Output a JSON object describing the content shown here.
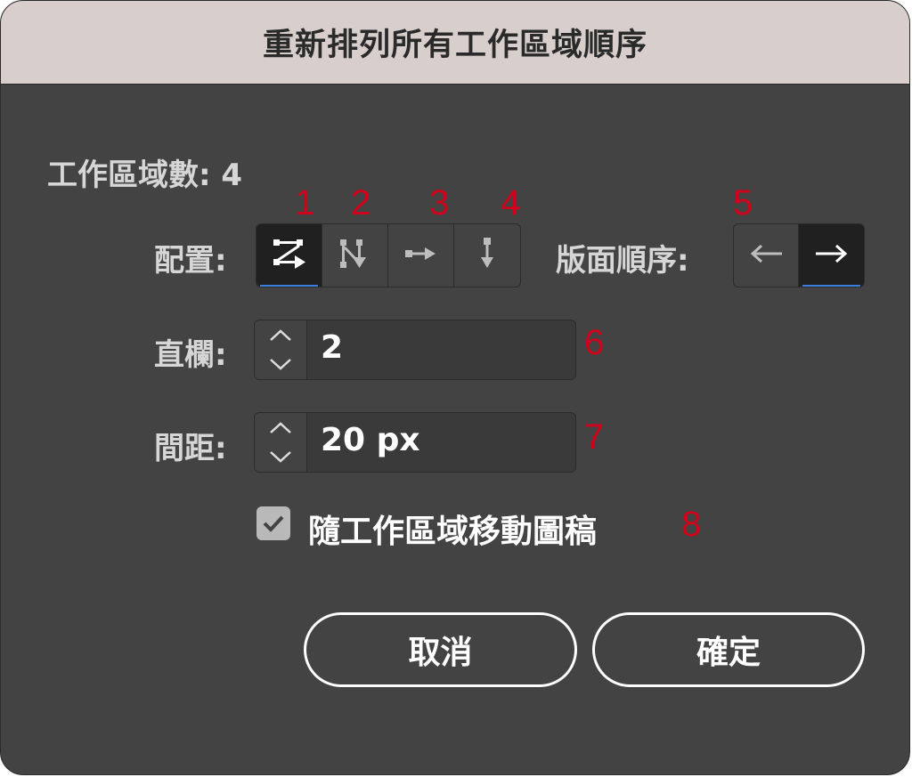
{
  "dialog": {
    "title": "重新排列所有工作區域順序",
    "artboard_count_label": "工作區域數: 4",
    "layout_label": "配置:",
    "page_order_label": "版面順序:",
    "columns": {
      "label": "直欄:",
      "value": "2"
    },
    "spacing": {
      "label": "間距:",
      "value": "20 px"
    },
    "move_artwork": {
      "label": "隨工作區域移動圖稿",
      "checked": true
    },
    "layout_options": [
      {
        "icon": "grid-by-row-icon",
        "selected": true
      },
      {
        "icon": "grid-by-column-icon",
        "selected": false
      },
      {
        "icon": "arrange-by-row-icon",
        "selected": false
      },
      {
        "icon": "arrange-by-column-icon",
        "selected": false
      }
    ],
    "page_order_options": [
      {
        "icon": "arrow-left-icon",
        "selected": false
      },
      {
        "icon": "arrow-right-icon",
        "selected": true
      }
    ],
    "buttons": {
      "cancel": "取消",
      "ok": "確定"
    }
  },
  "annotations": [
    "1",
    "2",
    "3",
    "4",
    "5",
    "6",
    "7",
    "8"
  ],
  "colors": {
    "title_bar": "#d8cfcd",
    "dialog_bg": "#434343",
    "selected_segment": "#202020",
    "focus_underline": "#3b7ddd",
    "annotation": "#d0021b"
  }
}
